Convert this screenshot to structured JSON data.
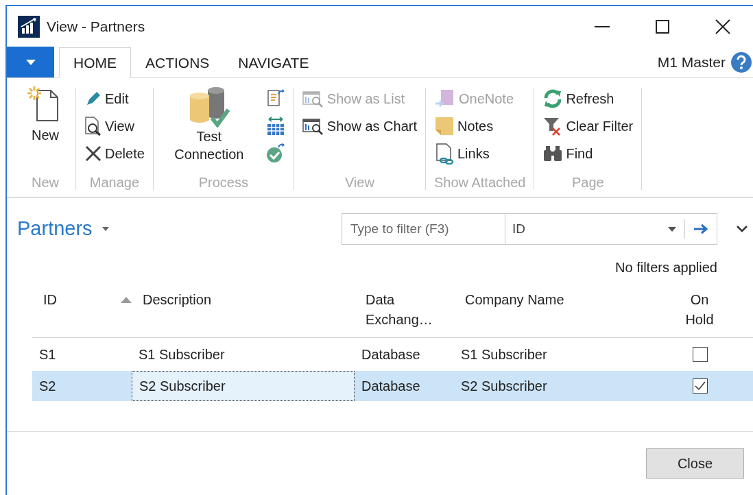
{
  "window": {
    "title": "View - Partners"
  },
  "ribbon_tabs": [
    {
      "label": "HOME",
      "selected": true
    },
    {
      "label": "ACTIONS",
      "selected": false
    },
    {
      "label": "NAVIGATE",
      "selected": false
    }
  ],
  "user": "M1 Master",
  "ribbon_groups": [
    {
      "label": "New",
      "columns": [
        [
          {
            "kind": "new",
            "label": "New",
            "large": true,
            "disabled": false
          }
        ]
      ]
    },
    {
      "label": "Manage",
      "columns": [
        [
          {
            "kind": "edit",
            "label": "Edit",
            "large": false,
            "disabled": false
          },
          {
            "kind": "view",
            "label": "View",
            "large": false,
            "disabled": false
          },
          {
            "kind": "delete",
            "label": "Delete",
            "large": false,
            "disabled": false
          }
        ]
      ]
    },
    {
      "label": "Process",
      "columns": [
        [
          {
            "kind": "test-connection",
            "label": "Test Connection",
            "large": true,
            "disabled": false
          }
        ],
        [
          {
            "kind": "document-arrow",
            "large": false,
            "disabled": false
          },
          {
            "kind": "table-arrows",
            "large": false,
            "disabled": false
          },
          {
            "kind": "check-arrow",
            "large": false,
            "disabled": false
          }
        ]
      ]
    },
    {
      "label": "View",
      "columns": [
        [
          {
            "kind": "list",
            "label": "Show as List",
            "large": false,
            "disabled": true
          },
          {
            "kind": "chart",
            "label": "Show as Chart",
            "large": false,
            "disabled": false
          }
        ]
      ]
    },
    {
      "label": "Show Attached",
      "columns": [
        [
          {
            "kind": "onenote",
            "label": "OneNote",
            "large": false,
            "disabled": true
          },
          {
            "kind": "notes",
            "label": "Notes",
            "large": false,
            "disabled": false
          },
          {
            "kind": "links",
            "label": "Links",
            "large": false,
            "disabled": false
          }
        ]
      ]
    },
    {
      "label": "Page",
      "columns": [
        [
          {
            "kind": "refresh",
            "label": "Refresh",
            "large": false,
            "disabled": false
          },
          {
            "kind": "clear-filter",
            "label": "Clear Filter",
            "large": false,
            "disabled": false
          },
          {
            "kind": "find",
            "label": "Find",
            "large": false,
            "disabled": false
          }
        ]
      ]
    }
  ],
  "page_title": "Partners",
  "filter": {
    "placeholder": "Type to filter (F3)",
    "field": "ID"
  },
  "filter_status": "No filters applied",
  "table": {
    "columns": [
      {
        "label": "ID",
        "sorted": true
      },
      {
        "label": "Description"
      },
      {
        "label": "Data Exchang…"
      },
      {
        "label": "Company Name"
      },
      {
        "label": "On Hold"
      }
    ],
    "rows": [
      {
        "selected": false,
        "cells": [
          {
            "text": "S1",
            "focused": false
          },
          {
            "text": "S1 Subscriber",
            "focused": false
          },
          {
            "text": "Database",
            "focused": false
          },
          {
            "text": "S1 Subscriber",
            "focused": false
          }
        ],
        "on_hold": false
      },
      {
        "selected": true,
        "cells": [
          {
            "text": "S2",
            "focused": false
          },
          {
            "text": "S2 Subscriber",
            "focused": true
          },
          {
            "text": "Database",
            "focused": false
          },
          {
            "text": "S2 Subscriber",
            "focused": false
          }
        ],
        "on_hold": true
      }
    ]
  },
  "buttons": [
    "Close"
  ]
}
